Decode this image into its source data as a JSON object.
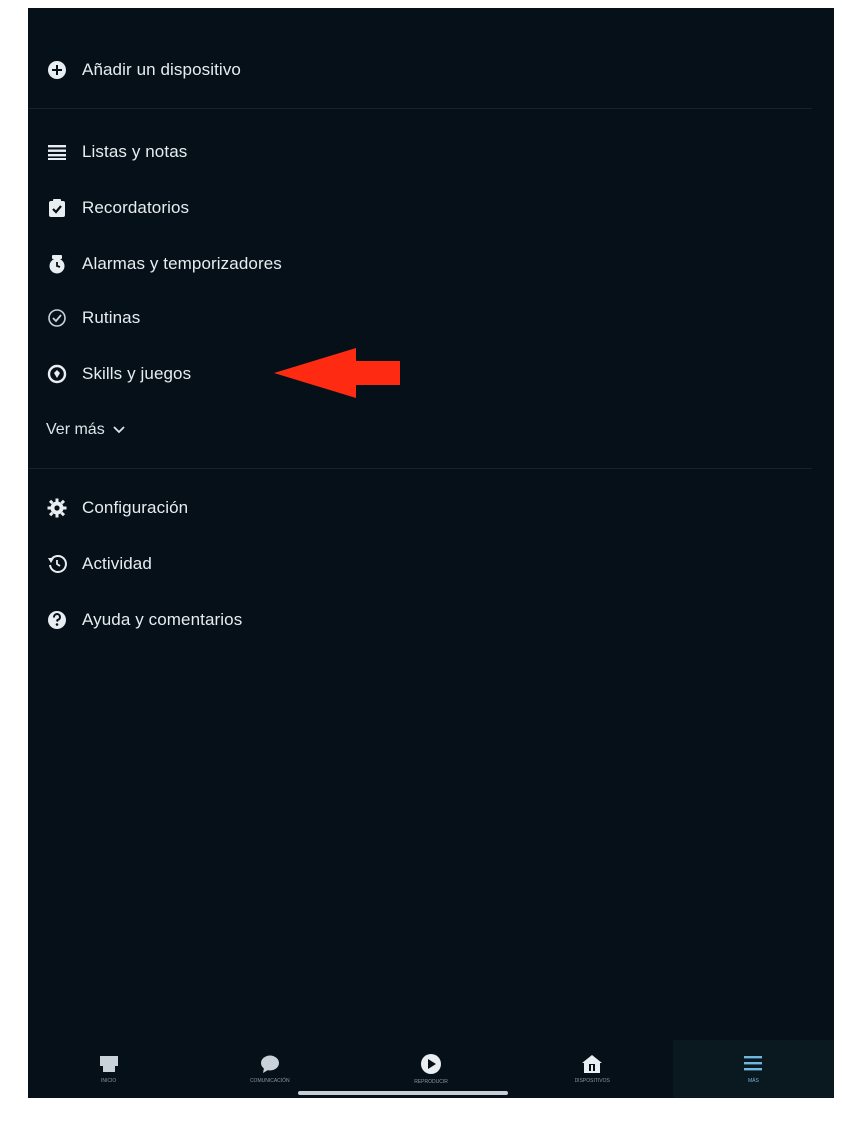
{
  "menu": {
    "add_device": "Añadir un dispositivo",
    "items": [
      {
        "label": "Listas y notas",
        "icon": "list-icon"
      },
      {
        "label": "Recordatorios",
        "icon": "clipboard-check-icon"
      },
      {
        "label": "Alarmas y temporizadores",
        "icon": "alarm-clock-icon"
      },
      {
        "label": "Rutinas",
        "icon": "check-circle-icon"
      },
      {
        "label": "Skills y juegos",
        "icon": "skills-icon"
      }
    ],
    "see_more": "Ver más",
    "settings_items": [
      {
        "label": "Configuración",
        "icon": "gear-icon"
      },
      {
        "label": "Actividad",
        "icon": "history-icon"
      },
      {
        "label": "Ayuda y comentarios",
        "icon": "help-icon"
      }
    ]
  },
  "annotation": {
    "arrow_color": "#ff2a12",
    "points_to": "Skills y juegos"
  },
  "tabbar": {
    "tabs": [
      {
        "label": "INICIO",
        "icon": "home-icon"
      },
      {
        "label": "COMUNICACIÓN",
        "icon": "chat-bubble-icon"
      },
      {
        "label": "REPRODUCIR",
        "icon": "play-icon"
      },
      {
        "label": "DISPOSITIVOS",
        "icon": "devices-icon"
      },
      {
        "label": "MÁS",
        "icon": "menu-icon",
        "active": true
      }
    ]
  },
  "colors": {
    "background": "#061018",
    "text": "#e6edf1",
    "active_tab": "#6fb6e0"
  }
}
